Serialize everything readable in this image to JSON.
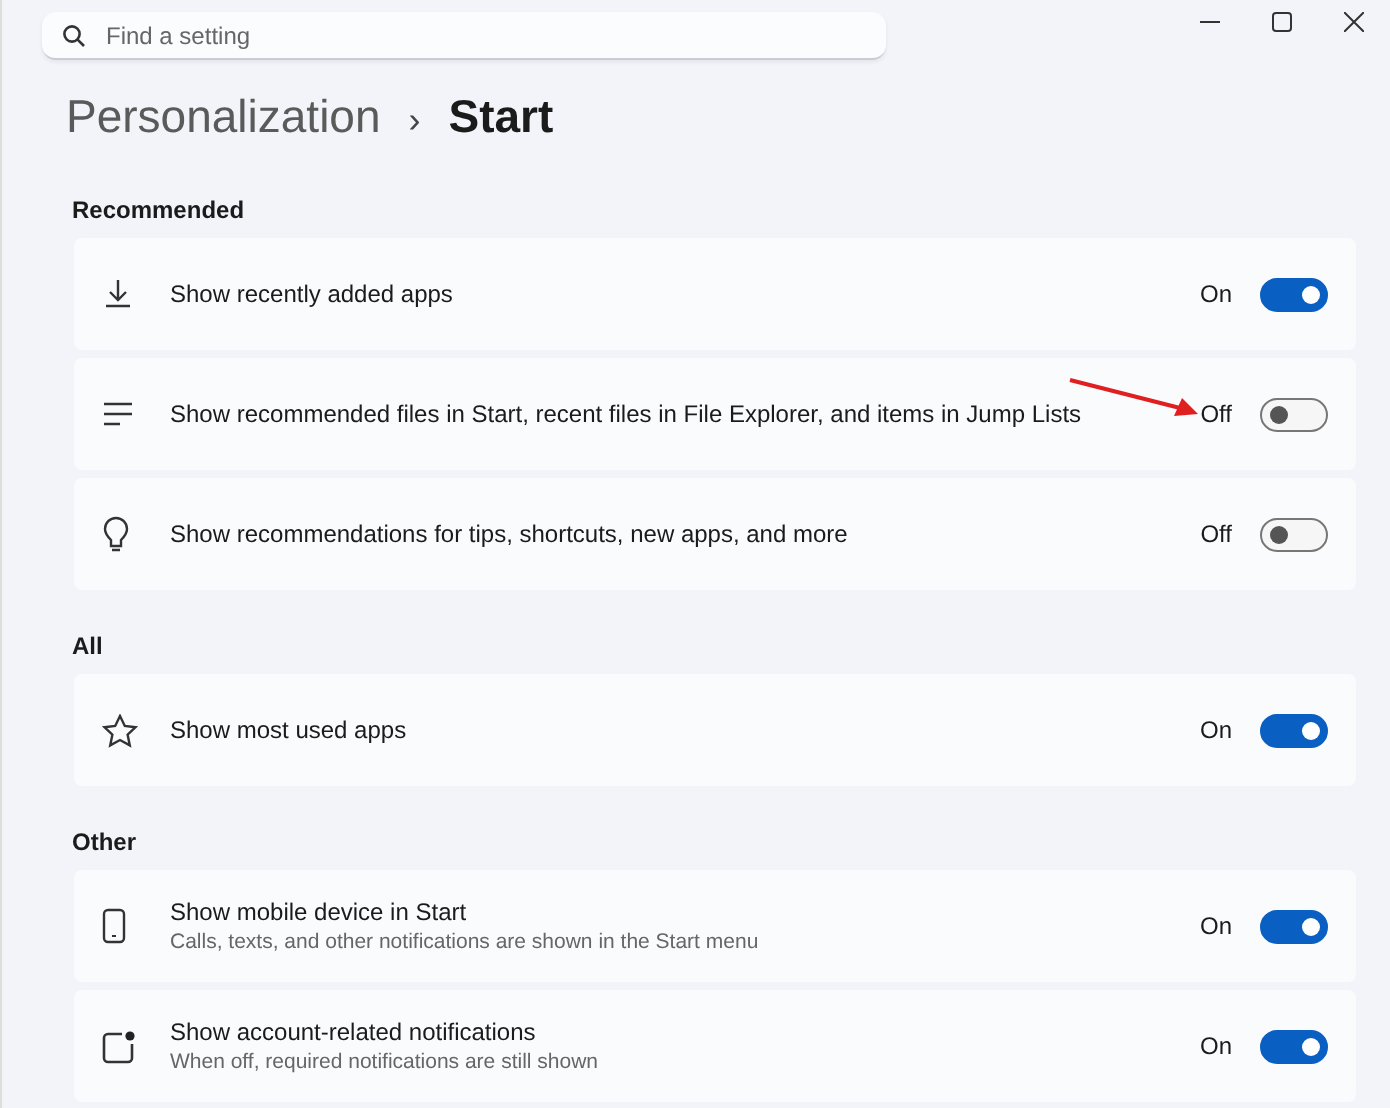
{
  "search": {
    "placeholder": "Find a setting"
  },
  "breadcrumb": {
    "parent": "Personalization",
    "separator": "›",
    "current": "Start"
  },
  "sections": [
    {
      "title": "Recommended",
      "items": [
        {
          "label": "Show recently added apps",
          "state_text": "On",
          "on": true
        },
        {
          "label": "Show recommended files in Start, recent files in File Explorer, and items in Jump Lists",
          "state_text": "Off",
          "on": false,
          "annotated": true
        },
        {
          "label": "Show recommendations for tips, shortcuts, new apps, and more",
          "state_text": "Off",
          "on": false
        }
      ]
    },
    {
      "title": "All",
      "items": [
        {
          "label": "Show most used apps",
          "state_text": "On",
          "on": true
        }
      ]
    },
    {
      "title": "Other",
      "items": [
        {
          "label": "Show mobile device in Start",
          "description": "Calls, texts, and other notifications are shown in the Start menu",
          "state_text": "On",
          "on": true
        },
        {
          "label": "Show account-related notifications",
          "description": "When off, required notifications are still shown",
          "state_text": "On",
          "on": true
        }
      ]
    }
  ]
}
